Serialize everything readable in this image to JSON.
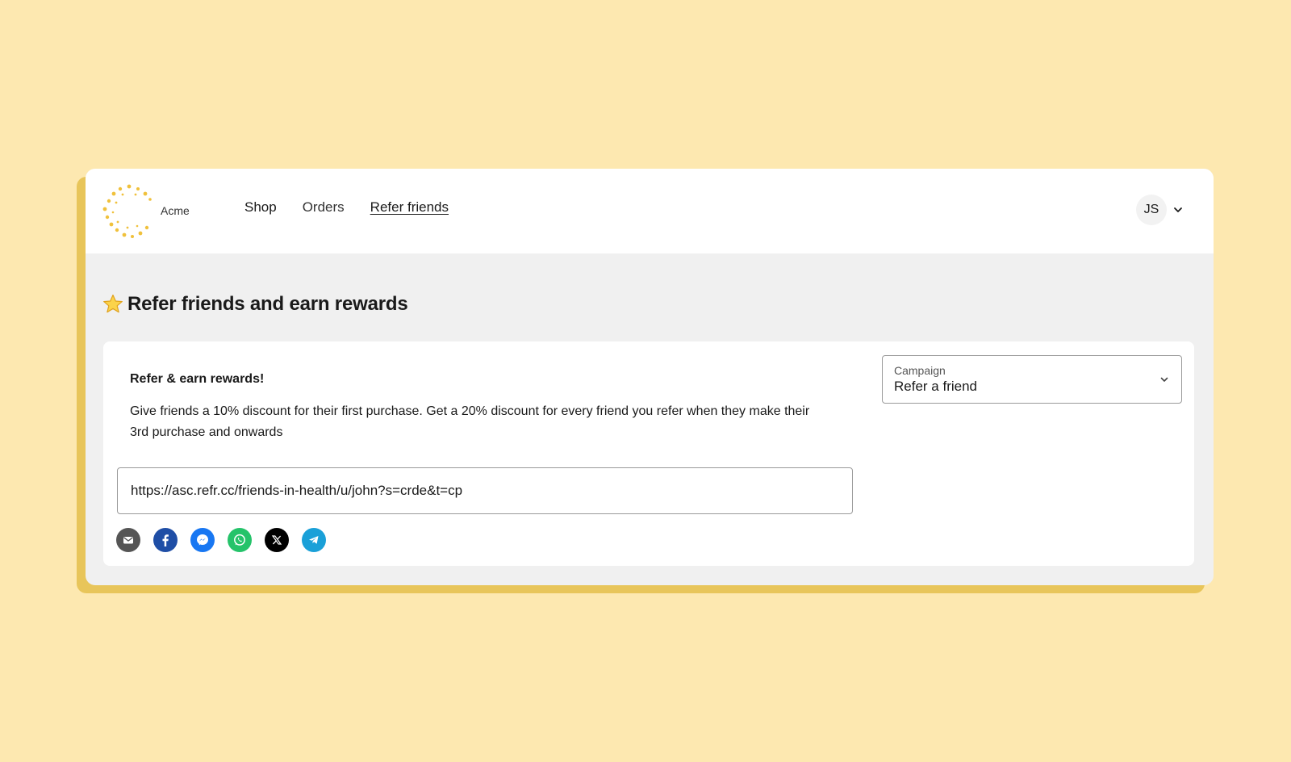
{
  "brand": {
    "name": "Acme",
    "logo_color": "#f0c13c"
  },
  "nav": {
    "links": [
      {
        "label": "Shop",
        "active": false
      },
      {
        "label": "Orders",
        "active": false
      },
      {
        "label": "Refer friends",
        "active": true
      }
    ]
  },
  "user": {
    "initials": "JS",
    "menu_icon": "chevron-down-icon"
  },
  "page": {
    "title_icon": "star-icon",
    "title": "Refer friends and earn rewards"
  },
  "card": {
    "heading": "Refer & earn rewards!",
    "description": "Give friends a 10% discount for their first purchase. Get a 20% discount for every friend you refer when they make their 3rd purchase and onwards",
    "referral_url": "https://asc.refr.cc/friends-in-health/u/john?s=crde&t=cp",
    "share_options": [
      {
        "name": "email-icon",
        "color": "#555555"
      },
      {
        "name": "facebook-icon",
        "color": "#1f4ea6"
      },
      {
        "name": "messenger-icon",
        "color": "#1877f2"
      },
      {
        "name": "whatsapp-icon",
        "color": "#25c36a"
      },
      {
        "name": "x-icon",
        "color": "#000000"
      },
      {
        "name": "telegram-icon",
        "color": "#1aa0d8"
      }
    ]
  },
  "campaign": {
    "label": "Campaign",
    "selected": "Refer a friend"
  },
  "colors": {
    "page_background": "#fde8b0",
    "shadow_accent": "#e8c55a",
    "content_background": "#f0f0f0"
  }
}
